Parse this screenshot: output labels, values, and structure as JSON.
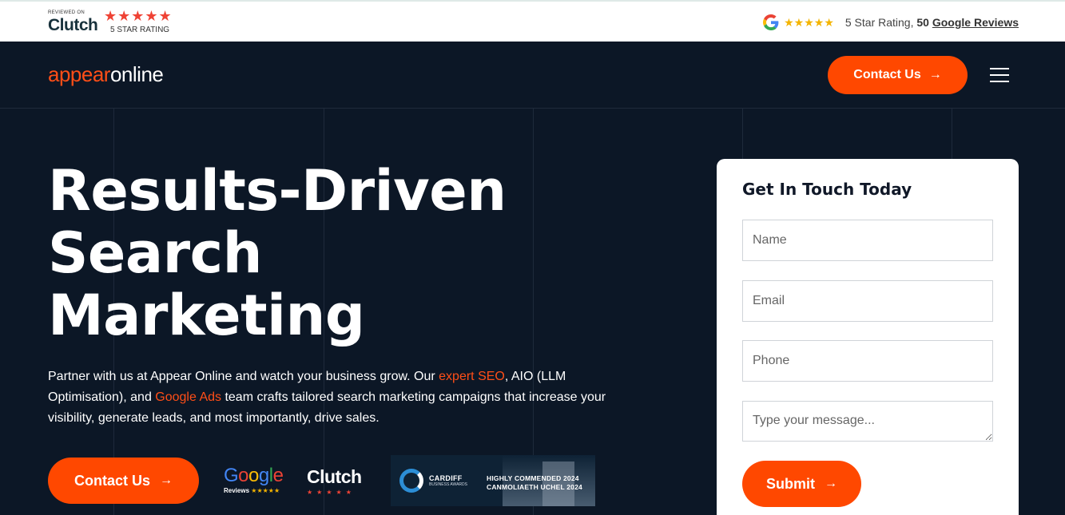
{
  "topbar": {
    "clutch": {
      "reviewed_on": "REVIEWED ON",
      "brand": "Clutch",
      "stars": "★★★★★",
      "rating": "5 STAR RATING"
    },
    "google": {
      "stars": "★★★★★",
      "rating_prefix": "5 Star Rating,",
      "review_count": "50",
      "reviews_link": "Google Reviews"
    }
  },
  "header": {
    "logo_part1": "appear",
    "logo_part2": "online",
    "contact_label": "Contact Us",
    "arrow": "→"
  },
  "hero": {
    "title_line1": "Results-Driven",
    "title_line2": "Search",
    "title_line3": "Marketing",
    "text_part1": "Partner with us at Appear Online and watch your business grow. Our ",
    "text_link1": "expert SEO",
    "text_part2": ", AIO (LLM Optimisation), and ",
    "text_link2": "Google Ads",
    "text_part3": " team crafts tailored search marketing campaigns that increase your visibility, generate leads, and most importantly, drive sales.",
    "contact_label": "Contact Us",
    "arrow": "→"
  },
  "badges": {
    "google": {
      "letters": [
        "G",
        "o",
        "o",
        "g",
        "l",
        "e"
      ],
      "sub_label": "Reviews",
      "stars": "★★★★★"
    },
    "clutch": {
      "word": "Clutch",
      "stars": "★★★★★"
    },
    "cardiff": {
      "name": "CARDIFF",
      "sub": "BUSINESS AWARDS",
      "award_line1": "HIGHLY COMMENDED 2024",
      "award_line2": "CANMOLIAETH UCHEL 2024"
    }
  },
  "form": {
    "title": "Get In Touch Today",
    "name_placeholder": "Name",
    "email_placeholder": "Email",
    "phone_placeholder": "Phone",
    "message_placeholder": "Type your message...",
    "submit_label": "Submit",
    "arrow": "→"
  },
  "colors": {
    "accent": "#ff4800",
    "dark_bg": "#0c1726",
    "google_blue": "#4285f4",
    "google_red": "#ea4335",
    "google_yellow": "#fbbc05",
    "google_green": "#34a853"
  }
}
